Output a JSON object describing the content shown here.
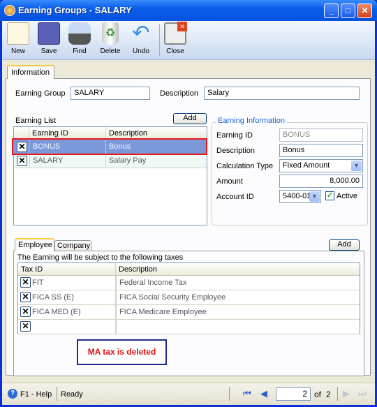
{
  "window": {
    "title": "Earning Groups - SALARY"
  },
  "toolbar": {
    "new": "New",
    "save": "Save",
    "find": "Find",
    "delete": "Delete",
    "undo": "Undo",
    "close": "Close"
  },
  "tabs": {
    "information": "Information"
  },
  "form": {
    "earning_group_label": "Earning Group",
    "earning_group_value": "SALARY",
    "description_label": "Description",
    "description_value": "Salary"
  },
  "earning_list": {
    "label": "Earning List",
    "add": "Add",
    "columns": [
      "Earning ID",
      "Description"
    ],
    "rows": [
      {
        "id": "BONUS",
        "description": "Bonus"
      },
      {
        "id": "SALARY",
        "description": "Salary Pay"
      }
    ]
  },
  "earning_info": {
    "legend": "Earning Information",
    "earning_id_label": "Earning ID",
    "earning_id": "BONUS",
    "description_label": "Description",
    "description": "Bonus",
    "calc_type_label": "Calculation Type",
    "calc_type": "Fixed Amount",
    "amount_label": "Amount",
    "amount": "8,000.00",
    "account_id_label": "Account ID",
    "account_id": "5400-01",
    "active_label": "Active",
    "active": true
  },
  "taxes": {
    "tabs": [
      "Employee",
      "Company"
    ],
    "add": "Add",
    "note": "The Earning will be subject to the following taxes",
    "columns": [
      "Tax ID",
      "Description"
    ],
    "rows": [
      {
        "id": "FIT",
        "description": "Federal Income Tax"
      },
      {
        "id": "FICA SS (E)",
        "description": "FICA Social Security Employee"
      },
      {
        "id": "FICA MED (E)",
        "description": "FICA Medicare Employee"
      },
      {
        "id": "",
        "description": ""
      }
    ]
  },
  "annotation": "MA tax is deleted",
  "status": {
    "help": "F1 - Help",
    "state": "Ready",
    "page": "2",
    "of": "of",
    "total": "2"
  }
}
